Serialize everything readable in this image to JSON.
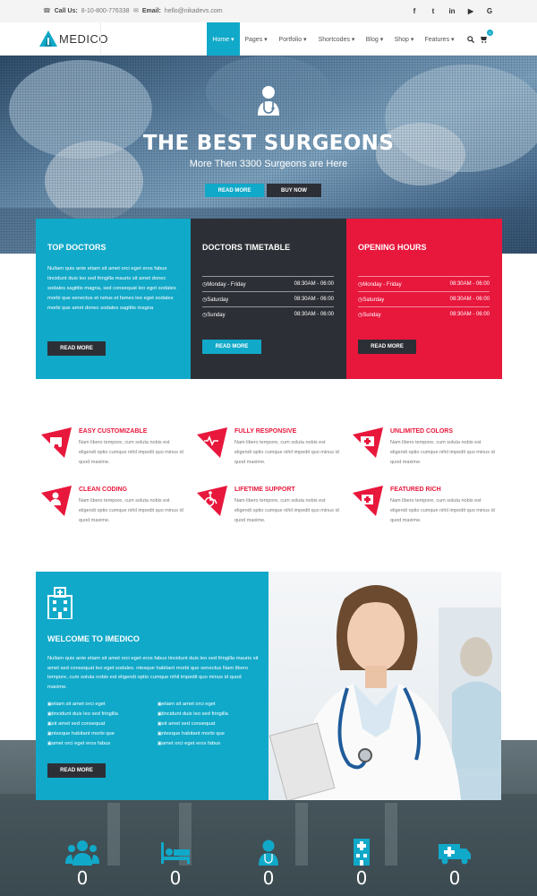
{
  "topbar": {
    "call_label": "Call Us:",
    "phone": "8-10-800-776338",
    "email_label": "Email:",
    "email": "hello@nikadevs.com",
    "social": [
      {
        "name": "facebook-icon",
        "glyph": "f"
      },
      {
        "name": "twitter-icon",
        "glyph": "t"
      },
      {
        "name": "linkedin-icon",
        "glyph": "in"
      },
      {
        "name": "youtube-icon",
        "glyph": "▶"
      },
      {
        "name": "google-icon",
        "glyph": "G"
      }
    ]
  },
  "nav": {
    "logo": "MEDICO",
    "items": [
      "Home ▾",
      "Pages ▾",
      "Portfolio ▾",
      "Shortcodes ▾",
      "Blog ▾",
      "Shop ▾",
      "Features ▾"
    ],
    "cart_count": "0"
  },
  "hero": {
    "title": "THE BEST SURGEONS",
    "subtitle": "More Then 3300 Surgeons are Here",
    "btn_read": "READ MORE",
    "btn_buy": "BUY NOW"
  },
  "panels": {
    "doctors": {
      "title": "TOP DOCTORS",
      "text": "Nullam quis ante etiam sit amet orci eget eros fabus tincidunt duis leo sed fringilla mauris sit amet donec sodales sagittis magna, sed consequat leo eget sodales morbi que senectus et netus et fames leo eget sodales morbi que amet donec sodales sagittis magna",
      "btn": "READ MORE"
    },
    "timetable": {
      "title": "DOCTORS TIMETABLE",
      "rows": [
        {
          "day": "Monday - Friday",
          "time": "08:30AM - 06:00"
        },
        {
          "day": "Saturday",
          "time": "08:30AM - 06:00"
        },
        {
          "day": "Sunday",
          "time": "08:30AM - 06:00"
        }
      ],
      "btn": "READ MORE"
    },
    "hours": {
      "title": "OPENING HOURS",
      "rows": [
        {
          "day": "Monday - Friday",
          "time": "08:30AM - 06:00"
        },
        {
          "day": "Saturday",
          "time": "08:30AM - 06:00"
        },
        {
          "day": "Sunday",
          "time": "08:30AM - 06:00"
        }
      ],
      "btn": "READ MORE"
    }
  },
  "features": [
    {
      "title": "EASY CUSTOMIZABLE",
      "icon": "ambulance-icon",
      "text": "Nam libero tempore, cum soluta nobis est eligendi optio cumque nihil impedit quo minus id quod maxime."
    },
    {
      "title": "FULLY RESPONSIVE",
      "icon": "heartbeat-icon",
      "text": "Nam libero tempore, cum soluta nobis est eligendi optio cumque nihil impedit quo minus id quod maxime."
    },
    {
      "title": "UNLIMITED COLORS",
      "icon": "medkit-icon",
      "text": "Nam libero tempore, cum soluta nobis est eligendi optio cumque nihil impedit quo minus id quod maxime."
    },
    {
      "title": "CLEAN CODING",
      "icon": "user-md-icon",
      "text": "Nam libero tempore, cum soluta nobis est eligendi optio cumque nihil impedit quo minus id quod maxime."
    },
    {
      "title": "LIFETIME SUPPORT",
      "icon": "wheelchair-icon",
      "text": "Nam libero tempore, cum soluta nobis est eligendi optio cumque nihil impedit quo minus id quod maxime."
    },
    {
      "title": "FEATURED RICH",
      "icon": "hospital-sign-icon",
      "text": "Nam libero tempore, cum soluta nobis est eligendi optio cumque nihil impedit quo minus id quod maxime."
    }
  ],
  "welcome": {
    "title": "WELCOME TO IMEDICO",
    "text": "Nullam quis ante etiam sit amet orci eget eros fabus tincidunt duis leo sed fringilla mauris sit amet sed consequat leo eget sodales. ntesque habitant morbi que senectus Nam libero tempore, cum soluta nobis est eligendi optio cumque nihil impedit quo minus id quod maxime.",
    "list_left": [
      "etiam sit amet orci eget",
      "tincidunt duis leo sed fringilla",
      "sit amet sed consequat",
      "ntesque habitant morbi que",
      "amet orci eget eros fabus"
    ],
    "list_right": [
      "etiam sit amet orci eget",
      "tincidunt duis leo sed fringilla",
      "sit amet sed consequat",
      "ntesque habitant morbi que",
      "amet orci eget eros fabus"
    ],
    "btn": "READ MORE"
  },
  "stats": [
    {
      "icon": "users-icon",
      "value": "0"
    },
    {
      "icon": "bed-icon",
      "value": "0"
    },
    {
      "icon": "doctor-icon",
      "value": "0"
    },
    {
      "icon": "hospital-icon",
      "value": "0"
    },
    {
      "icon": "ambulance-icon",
      "value": "0"
    }
  ],
  "colors": {
    "accent": "#11a9c9",
    "red": "#e8173c",
    "dark": "#2d2f36"
  }
}
